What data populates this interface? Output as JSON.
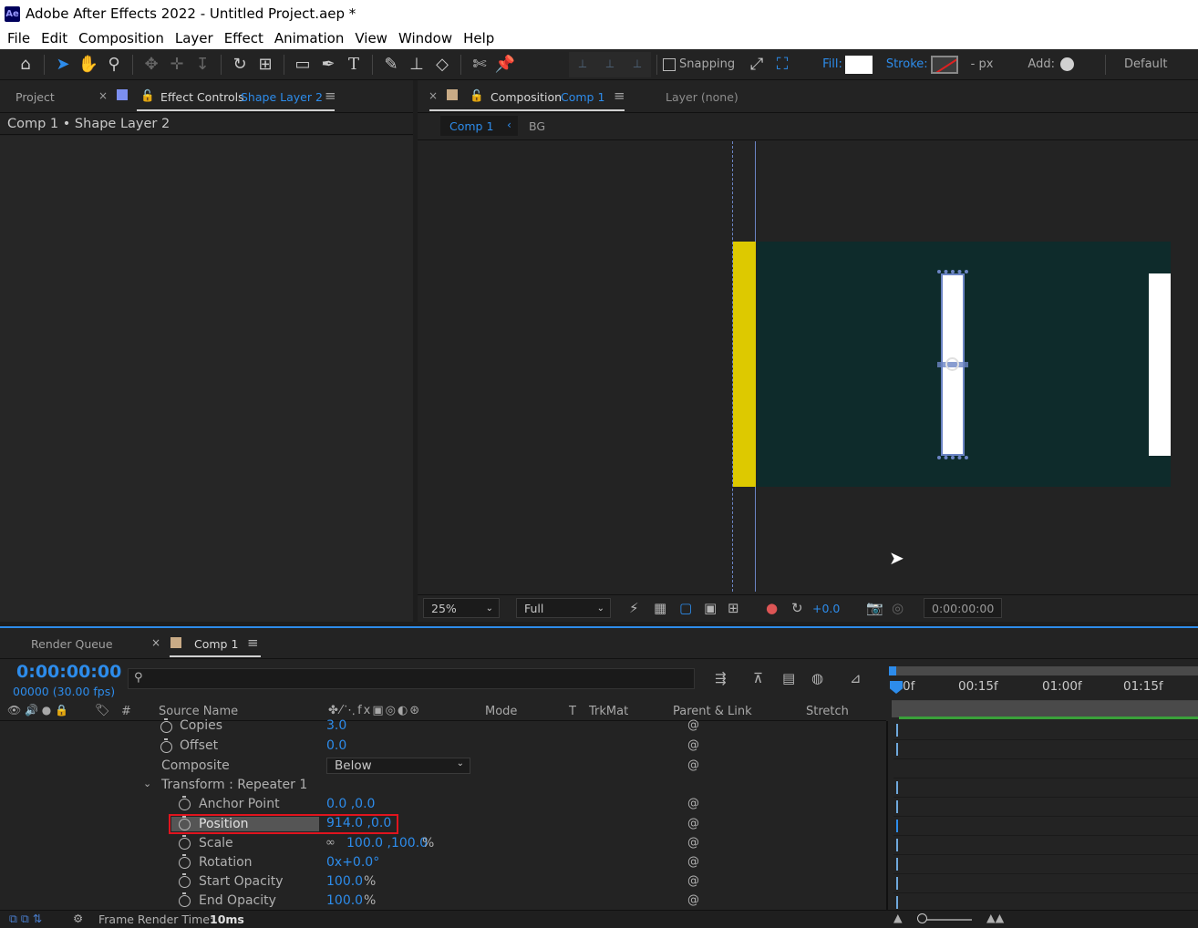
{
  "window": {
    "app_badge": "Ae",
    "title": "Adobe After Effects 2022 - Untitled Project.aep *"
  },
  "menu": [
    "File",
    "Edit",
    "Composition",
    "Layer",
    "Effect",
    "Animation",
    "View",
    "Window",
    "Help"
  ],
  "toolbar": {
    "snapping_label": "Snapping",
    "fill_label": "Fill:",
    "stroke_label": "Stroke:",
    "stroke_width": "- px",
    "add_label": "Add:",
    "workspace": "Default"
  },
  "left_panel": {
    "tab_project": "Project",
    "tab_effect_controls": "Effect Controls",
    "tab_effect_controls_target": "Shape Layer 2",
    "header": "Comp 1 • Shape Layer 2"
  },
  "comp_panel": {
    "tab_label": "Composition",
    "tab_comp_name": "Comp 1",
    "layer_tab": "Layer (none)",
    "breadcrumb_active": "Comp 1",
    "breadcrumb_next": "BG",
    "zoom": "25%",
    "resolution": "Full",
    "exposure": "+0.0",
    "timecode": "0:00:00:00"
  },
  "colors": {
    "accent": "#2d8ceb",
    "yellow_bar": "#ddc900",
    "comp_bg": "#0e2b2b",
    "highlight_box": "#e0141e"
  },
  "timeline": {
    "tab_render_queue": "Render Queue",
    "tab_comp": "Comp 1",
    "current_time": "0:00:00:00",
    "frame_info": "00000 (30.00 fps)",
    "columns": {
      "hash": "#",
      "source_name": "Source Name",
      "mode": "Mode",
      "t": "T",
      "trkmat": "TrkMat",
      "parent": "Parent & Link",
      "stretch": "Stretch"
    },
    "ruler": [
      "0f",
      "00:15f",
      "01:00f",
      "01:15f"
    ],
    "rows": [
      {
        "label": "Copies",
        "value": "3.0"
      },
      {
        "label": "Offset",
        "value": "0.0"
      },
      {
        "label": "Composite",
        "value": "Below"
      },
      {
        "label": "Transform : Repeater 1"
      },
      {
        "label": "Anchor Point",
        "value": "0.0 ,0.0"
      },
      {
        "label": "Position",
        "value": "914.0 ,0.0"
      },
      {
        "label": "Scale",
        "value": "100.0 ,100.0",
        "unit": "%"
      },
      {
        "label": "Rotation",
        "value": "0x+0.0°"
      },
      {
        "label": "Start Opacity",
        "value": "100.0",
        "unit": "%"
      },
      {
        "label": "End Opacity",
        "value": "100.0",
        "unit": "%"
      }
    ],
    "footer_label": "Frame Render Time:",
    "footer_value": "10ms"
  }
}
